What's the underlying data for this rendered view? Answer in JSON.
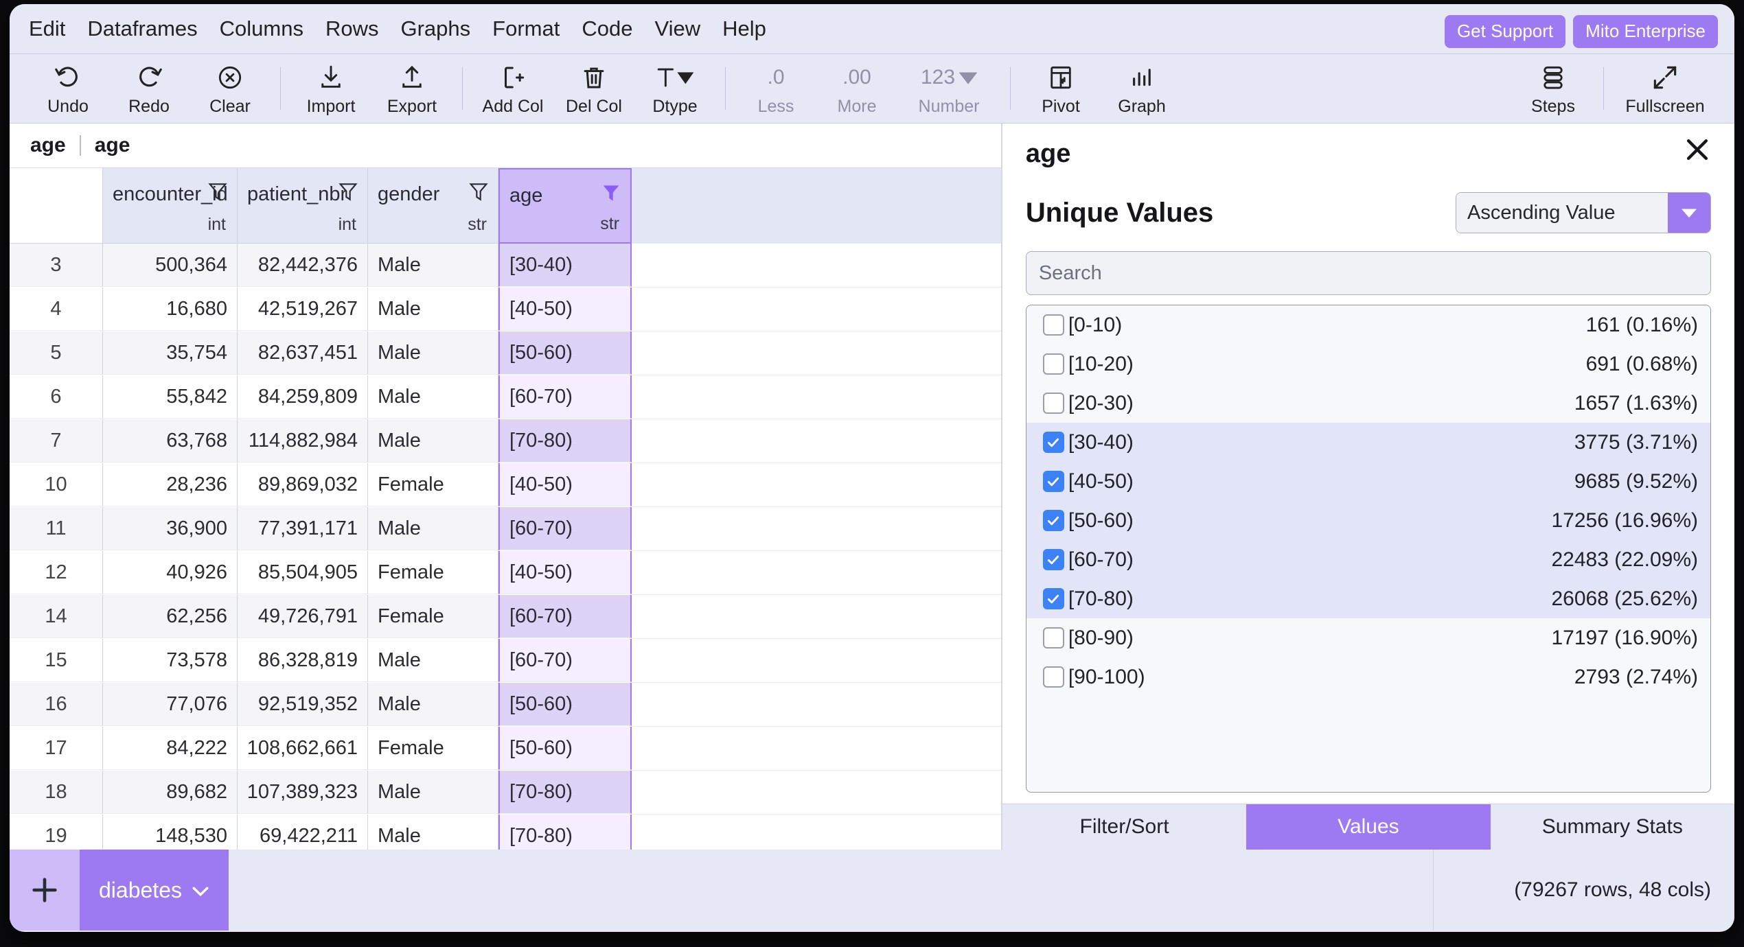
{
  "menubar": {
    "items": [
      "Edit",
      "Dataframes",
      "Columns",
      "Rows",
      "Graphs",
      "Format",
      "Code",
      "View",
      "Help"
    ],
    "get_support": "Get Support",
    "enterprise": "Mito Enterprise"
  },
  "toolbar": {
    "buttons": [
      {
        "label": "Undo",
        "icon": "undo-arrow-icon",
        "disabled": false
      },
      {
        "label": "Redo",
        "icon": "redo-arrow-icon",
        "disabled": false
      },
      {
        "label": "Clear",
        "icon": "circle-x-icon",
        "disabled": false
      },
      {
        "label": "Import",
        "icon": "download-icon",
        "disabled": false
      },
      {
        "label": "Export",
        "icon": "upload-icon",
        "disabled": false
      },
      {
        "label": "Add Col",
        "icon": "add-column-icon",
        "disabled": false
      },
      {
        "label": "Del Col",
        "icon": "trash-icon",
        "disabled": false
      },
      {
        "label": "Dtype",
        "icon": "dtype-icon",
        "disabled": false
      },
      {
        "label": "Less",
        "icon": "decimal-less-icon",
        "disabled": true
      },
      {
        "label": "More",
        "icon": "decimal-more-icon",
        "disabled": true
      },
      {
        "label": "Number",
        "icon": "number-format-icon",
        "disabled": true
      },
      {
        "label": "Pivot",
        "icon": "pivot-table-icon",
        "disabled": false
      },
      {
        "label": "Graph",
        "icon": "bar-chart-icon",
        "disabled": false
      }
    ],
    "right_buttons": [
      {
        "label": "Steps",
        "icon": "steps-icon"
      },
      {
        "label": "Fullscreen",
        "icon": "fullscreen-icon"
      }
    ]
  },
  "breadcrumb": {
    "dataframe": "age",
    "column": "age"
  },
  "grid": {
    "columns": [
      {
        "name": "encounter_id",
        "dtype": "int",
        "filter_active": false
      },
      {
        "name": "patient_nbr",
        "dtype": "int",
        "filter_active": false
      },
      {
        "name": "gender",
        "dtype": "str",
        "filter_active": false
      },
      {
        "name": "age",
        "dtype": "str",
        "filter_active": true
      }
    ],
    "rows": [
      {
        "index": "3",
        "encounter_id": "500,364",
        "patient_nbr": "82,442,376",
        "gender": "Male",
        "age": "[30-40)"
      },
      {
        "index": "4",
        "encounter_id": "16,680",
        "patient_nbr": "42,519,267",
        "gender": "Male",
        "age": "[40-50)"
      },
      {
        "index": "5",
        "encounter_id": "35,754",
        "patient_nbr": "82,637,451",
        "gender": "Male",
        "age": "[50-60)"
      },
      {
        "index": "6",
        "encounter_id": "55,842",
        "patient_nbr": "84,259,809",
        "gender": "Male",
        "age": "[60-70)"
      },
      {
        "index": "7",
        "encounter_id": "63,768",
        "patient_nbr": "114,882,984",
        "gender": "Male",
        "age": "[70-80)"
      },
      {
        "index": "10",
        "encounter_id": "28,236",
        "patient_nbr": "89,869,032",
        "gender": "Female",
        "age": "[40-50)"
      },
      {
        "index": "11",
        "encounter_id": "36,900",
        "patient_nbr": "77,391,171",
        "gender": "Male",
        "age": "[60-70)"
      },
      {
        "index": "12",
        "encounter_id": "40,926",
        "patient_nbr": "85,504,905",
        "gender": "Female",
        "age": "[40-50)"
      },
      {
        "index": "14",
        "encounter_id": "62,256",
        "patient_nbr": "49,726,791",
        "gender": "Female",
        "age": "[60-70)"
      },
      {
        "index": "15",
        "encounter_id": "73,578",
        "patient_nbr": "86,328,819",
        "gender": "Male",
        "age": "[60-70)"
      },
      {
        "index": "16",
        "encounter_id": "77,076",
        "patient_nbr": "92,519,352",
        "gender": "Male",
        "age": "[50-60)"
      },
      {
        "index": "17",
        "encounter_id": "84,222",
        "patient_nbr": "108,662,661",
        "gender": "Female",
        "age": "[50-60)"
      },
      {
        "index": "18",
        "encounter_id": "89,682",
        "patient_nbr": "107,389,323",
        "gender": "Male",
        "age": "[70-80)"
      },
      {
        "index": "19",
        "encounter_id": "148,530",
        "patient_nbr": "69,422,211",
        "gender": "Male",
        "age": "[70-80)"
      }
    ]
  },
  "panel": {
    "title": "age",
    "section_title": "Unique Values",
    "sort_selected": "Ascending Value",
    "search_placeholder": "Search",
    "values": [
      {
        "label": "[0-10)",
        "count": "161 (0.16%)",
        "checked": false
      },
      {
        "label": "[10-20)",
        "count": "691 (0.68%)",
        "checked": false
      },
      {
        "label": "[20-30)",
        "count": "1657 (1.63%)",
        "checked": false
      },
      {
        "label": "[30-40)",
        "count": "3775 (3.71%)",
        "checked": true
      },
      {
        "label": "[40-50)",
        "count": "9685 (9.52%)",
        "checked": true
      },
      {
        "label": "[50-60)",
        "count": "17256 (16.96%)",
        "checked": true
      },
      {
        "label": "[60-70)",
        "count": "22483 (22.09%)",
        "checked": true
      },
      {
        "label": "[70-80)",
        "count": "26068 (25.62%)",
        "checked": true
      },
      {
        "label": "[80-90)",
        "count": "17197 (16.90%)",
        "checked": false
      },
      {
        "label": "[90-100)",
        "count": "2793 (2.74%)",
        "checked": false
      }
    ],
    "tabs": [
      {
        "label": "Filter/Sort",
        "active": false
      },
      {
        "label": "Values",
        "active": true
      },
      {
        "label": "Summary Stats",
        "active": false
      }
    ]
  },
  "bottom": {
    "add_label": "+",
    "dataframe_tab": "diabetes",
    "status": "(79267 rows, 48 cols)"
  },
  "colors": {
    "accent": "#9d79f2",
    "accent_light": "#cdbcf7",
    "chrome": "#e6e8f5",
    "checkbox_blue": "#3b82f6"
  }
}
